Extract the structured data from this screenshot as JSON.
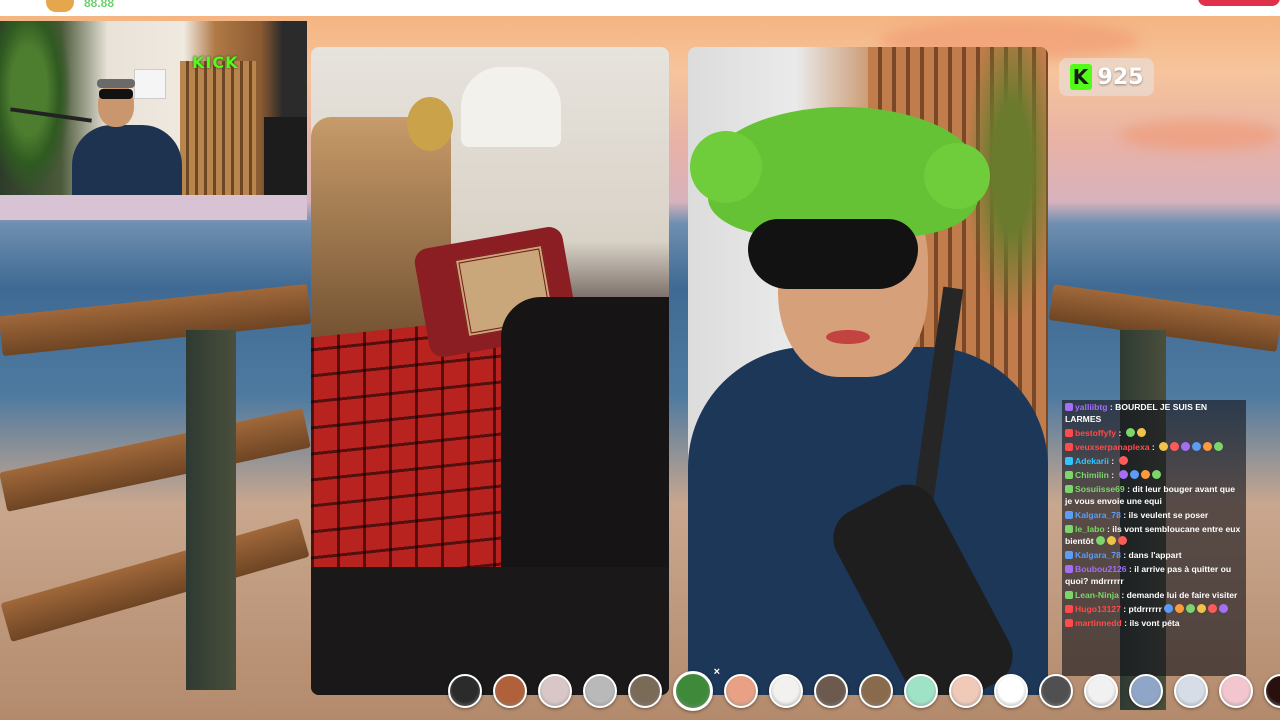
{
  "top_bar": {
    "viewer_count_partial": "88.88"
  },
  "webcam": {
    "sign_text": "KICK"
  },
  "viewers_badge": {
    "icon": "kick-k-icon",
    "count": "925"
  },
  "chat": {
    "messages": [
      {
        "user": "yalliibtg",
        "user_color": "#a46ef5",
        "text": "BOURDEL JE SUIS EN LARMES",
        "emotes": 0
      },
      {
        "user": "bestoffyfy",
        "user_color": "#ff4b4b",
        "text": "",
        "emotes": 2
      },
      {
        "user": "veuxserpanaplexa",
        "user_color": "#ff4b4b",
        "text": "",
        "emotes": 6
      },
      {
        "user": "Adekarii",
        "user_color": "#33c4ff",
        "text": "",
        "emotes": 1
      },
      {
        "user": "Chimilin",
        "user_color": "#7cd66b",
        "text": "",
        "emotes": 4
      },
      {
        "user": "Sosuiisse69",
        "user_color": "#7cd66b",
        "text": "dit leur bouger avant que je vous envoie une equi",
        "emotes": 0
      },
      {
        "user": "Kalgara_78",
        "user_color": "#5d9cf5",
        "text": "ils veulent se poser",
        "emotes": 0
      },
      {
        "user": "le_labo",
        "user_color": "#7cd66b",
        "text": "ils vont sembloucane entre eux bientôt",
        "emotes": 3
      },
      {
        "user": "Kalgara_78",
        "user_color": "#5d9cf5",
        "text": "dans l'appart",
        "emotes": 0
      },
      {
        "user": "Boubou2126",
        "user_color": "#a46ef5",
        "text": "il arrive pas à quitter ou quoi? mdrrrrrr",
        "emotes": 0
      },
      {
        "user": "Lean-Ninja",
        "user_color": "#7cd66b",
        "text": "demande lui de faire visiter",
        "emotes": 0
      },
      {
        "user": "Hugo13127",
        "user_color": "#ff4b4b",
        "text": "ptdrrrrrr",
        "emotes": 6
      },
      {
        "user": "martinnedd",
        "user_color": "#ff4b4b",
        "text": "ils vont péta",
        "emotes": 0
      }
    ]
  },
  "filters": {
    "items": [
      {
        "name": "filter-none",
        "color": "#2b2b2b"
      },
      {
        "name": "filter-face-man",
        "color": "#b0603a"
      },
      {
        "name": "filter-baby",
        "color": "#d9c7c7"
      },
      {
        "name": "filter-sad-face",
        "color": "#b9b9b9"
      },
      {
        "name": "filter-donkey",
        "color": "#7a6a58"
      },
      {
        "name": "filter-green-monster",
        "color": "#3f8a3a"
      },
      {
        "name": "filter-peach",
        "color": "#e8a184"
      },
      {
        "name": "filter-white-face",
        "color": "#f3f1ef"
      },
      {
        "name": "filter-monkey",
        "color": "#6b5a4d"
      },
      {
        "name": "filter-beard",
        "color": "#8a6a4c"
      },
      {
        "name": "filter-alien",
        "color": "#9fe3c7"
      },
      {
        "name": "filter-skin",
        "color": "#f0c9b9"
      },
      {
        "name": "filter-stars",
        "color": "#ffffff"
      },
      {
        "name": "filter-dark-face",
        "color": "#505050"
      },
      {
        "name": "filter-panda",
        "color": "#f1f1f1"
      },
      {
        "name": "filter-blur",
        "color": "#8fa6c9"
      },
      {
        "name": "filter-ghost",
        "color": "#d7dde6"
      },
      {
        "name": "filter-pig",
        "color": "#f3c6cf"
      },
      {
        "name": "filter-devil",
        "color": "#2a0f0f"
      },
      {
        "name": "filter-more",
        "color": "#4a4a4a"
      }
    ],
    "selected_index": 5
  }
}
